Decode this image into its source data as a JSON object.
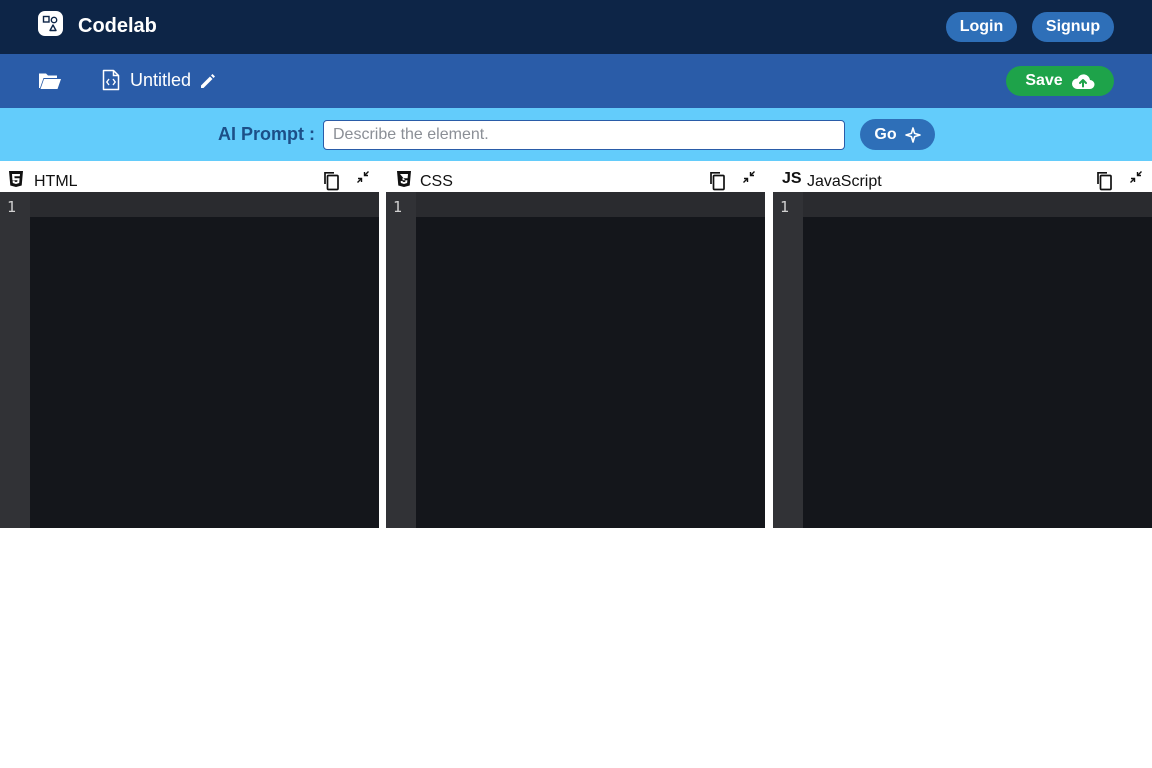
{
  "app": {
    "name": "Codelab"
  },
  "auth": {
    "login_label": "Login",
    "signup_label": "Signup"
  },
  "toolbar": {
    "project_title": "Untitled",
    "save_label": "Save"
  },
  "ai_prompt": {
    "label": "AI Prompt :",
    "placeholder": "Describe the element.",
    "value": "",
    "go_label": "Go"
  },
  "panels": [
    {
      "icon": "html5-icon",
      "label": "HTML",
      "line_numbers": [
        "1"
      ]
    },
    {
      "icon": "css3-icon",
      "label": "CSS",
      "line_numbers": [
        "1"
      ]
    },
    {
      "icon": "js-icon",
      "label": "JavaScript",
      "icon_text": "JS",
      "line_numbers": [
        "1"
      ]
    }
  ],
  "colors": {
    "topbar": "#0d2547",
    "toolbar": "#2a5ca8",
    "prompt_bar": "#63ccfb",
    "save_green": "#1ea34a",
    "pill_blue": "#2e6fb8",
    "editor_bg": "#14161b",
    "gutter_bg": "#313236"
  }
}
